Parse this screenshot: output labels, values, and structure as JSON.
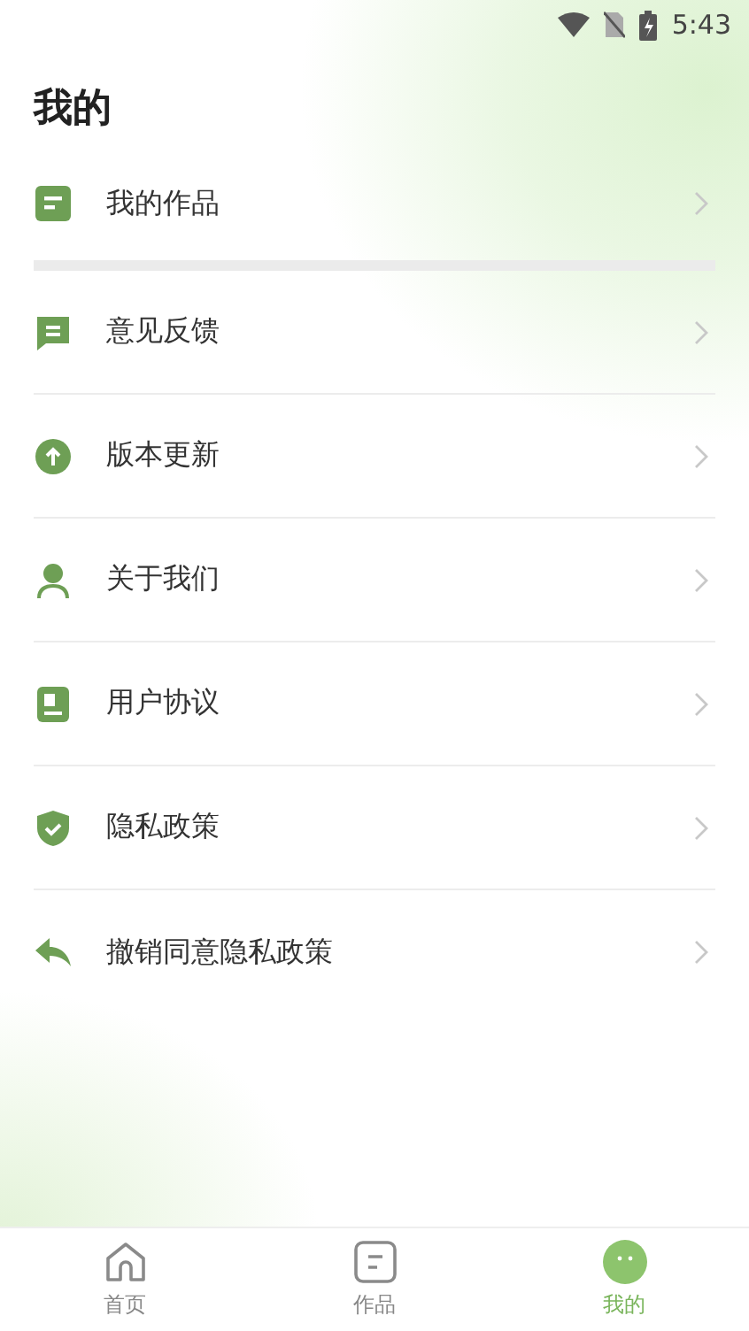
{
  "status_bar": {
    "time": "5:43"
  },
  "title": "我的",
  "top_items": [
    {
      "label": "我的作品",
      "kind": "works"
    }
  ],
  "items": [
    {
      "label": "意见反馈",
      "kind": "feedback"
    },
    {
      "label": "版本更新",
      "kind": "update"
    },
    {
      "label": "关于我们",
      "kind": "about"
    },
    {
      "label": "用户协议",
      "kind": "agreement"
    },
    {
      "label": "隐私政策",
      "kind": "privacy"
    },
    {
      "label": "撤销同意隐私政策",
      "kind": "revoke"
    }
  ],
  "tabs": [
    {
      "label": "首页",
      "kind": "home",
      "selected": false
    },
    {
      "label": "作品",
      "kind": "works",
      "selected": false
    },
    {
      "label": "我的",
      "kind": "face",
      "selected": true
    }
  ]
}
